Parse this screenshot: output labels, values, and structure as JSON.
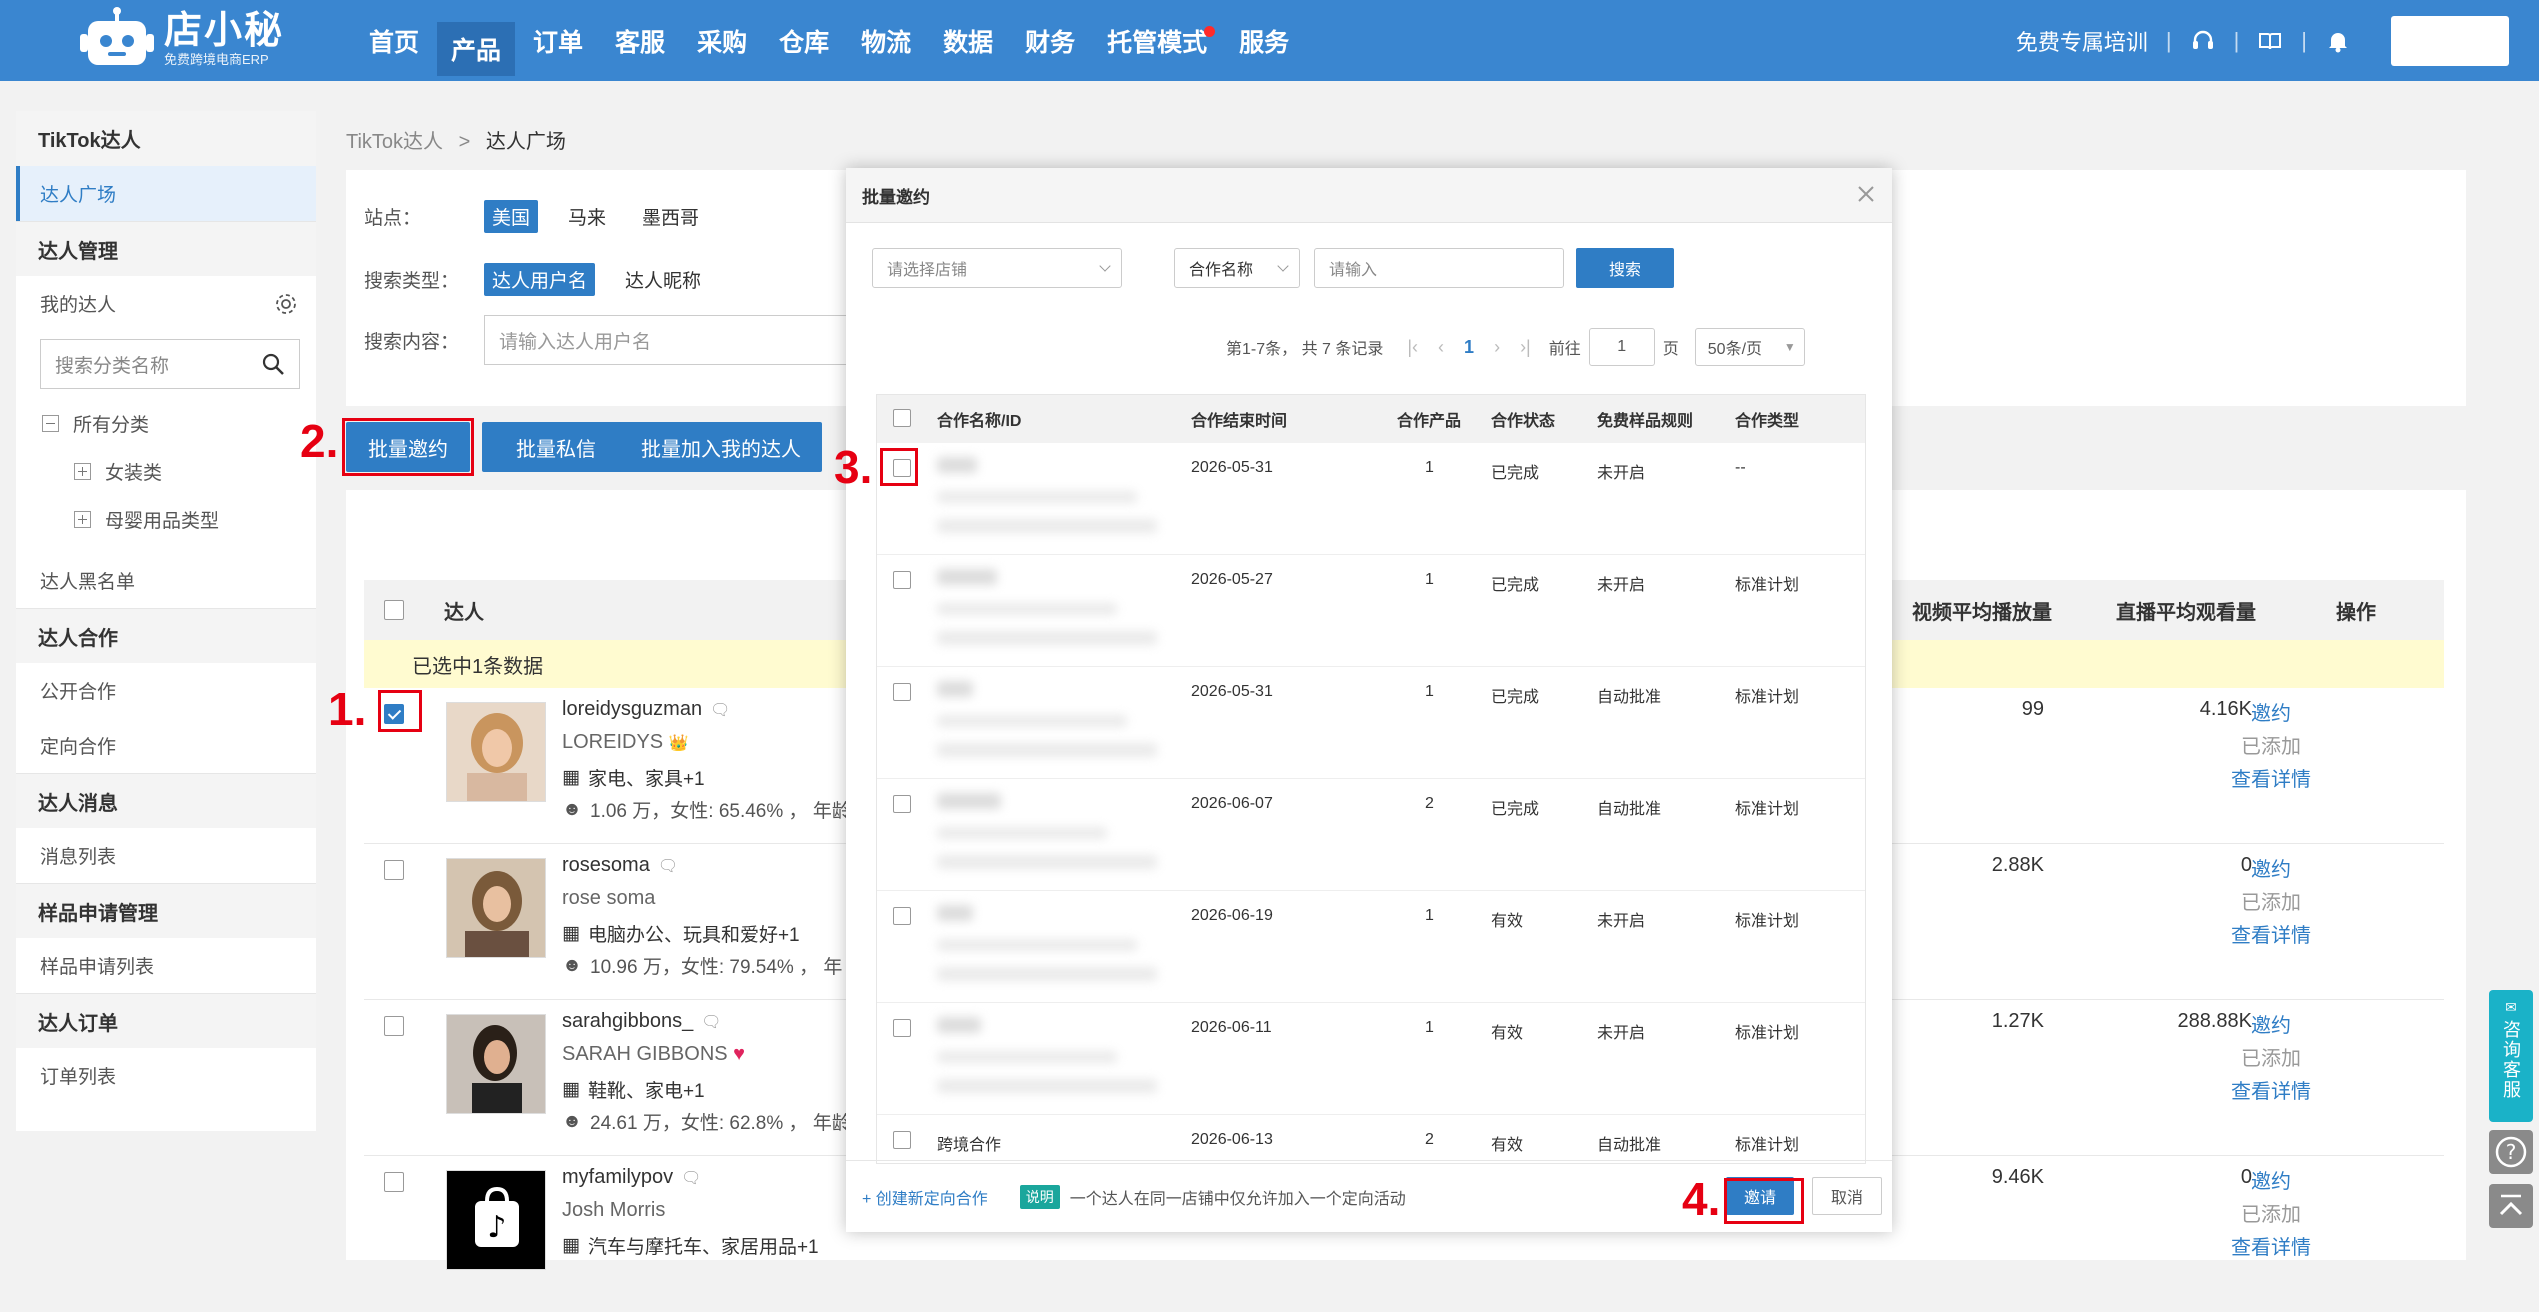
{
  "logo": {
    "name": "店小秘",
    "subtitle": "免费跨境电商ERP"
  },
  "nav": [
    "首页",
    "产品",
    "订单",
    "客服",
    "采购",
    "仓库",
    "物流",
    "数据",
    "财务",
    "托管模式",
    "服务"
  ],
  "top_right": {
    "training": "免费专属培训"
  },
  "sidebar": {
    "tiktok": "TikTok达人",
    "square": "达人广场",
    "manage": "达人管理",
    "my": "我的达人",
    "search_ph": "搜索分类名称",
    "all": "所有分类",
    "cat1": "女装类",
    "cat2": "母婴用品类型",
    "blacklist": "达人黑名单",
    "coop": "达人合作",
    "public": "公开合作",
    "directed": "定向合作",
    "msg": "达人消息",
    "msglist": "消息列表",
    "sample": "样品申请管理",
    "samplelist": "样品申请列表",
    "order": "达人订单",
    "orderlist": "订单列表"
  },
  "breadcrumb": {
    "parent": "TikTok达人",
    "sep": ">",
    "current": "达人广场"
  },
  "filters": {
    "site_label": "站点：",
    "sites": [
      "美国",
      "马来",
      "墨西哥"
    ],
    "type_label": "搜索类型：",
    "types": [
      "达人用户名",
      "达人昵称"
    ],
    "content_label": "搜索内容：",
    "content_ph": "请输入达人用户名"
  },
  "actions": {
    "batch_invite": "批量邀约",
    "batch_msg": "批量私信",
    "batch_add": "批量加入我的达人"
  },
  "steps": [
    "1.",
    "2.",
    "3.",
    "4."
  ],
  "list": {
    "col_creator": "达人",
    "col_video": "视频平均播放量",
    "col_live": "直播平均观看量",
    "col_op": "操作",
    "selected": "已选中1条数据",
    "rows": [
      {
        "user": "loreidysguzman",
        "nick": "LOREIDYS",
        "cats": "家电、家具+1",
        "fans": "1.06 万，女性: 65.46% ，  年龄",
        "video": "99",
        "live": "4.16K",
        "invite": "邀约",
        "added": "已添加",
        "detail": "查看详情"
      },
      {
        "user": "rosesoma",
        "nick": "rose soma",
        "cats": "电脑办公、玩具和爱好+1",
        "fans": "10.96 万，女性: 79.54% ，  年",
        "video": "2.88K",
        "live": "0",
        "invite": "邀约",
        "added": "已添加",
        "detail": "查看详情"
      },
      {
        "user": "sarahgibbons_",
        "nick": "SARAH GIBBONS",
        "cats": "鞋靴、家电+1",
        "fans": "24.61 万，女性: 62.8% ，  年龄",
        "video": "1.27K",
        "live": "288.88K",
        "invite": "邀约",
        "added": "已添加",
        "detail": "查看详情"
      },
      {
        "user": "myfamilypov",
        "nick": "Josh Morris",
        "cats": "汽车与摩托车、家居用品+1",
        "fans": "",
        "video": "9.46K",
        "live": "0",
        "invite": "邀约",
        "added": "已添加",
        "detail": "查看详情"
      }
    ]
  },
  "modal": {
    "title": "批量邀约",
    "store_ph": "请选择店铺",
    "field": "合作名称",
    "input_ph": "请输入",
    "search": "搜索",
    "pager_info": "第1-7条，  共 7 条记录",
    "page": "1",
    "goto": "前往",
    "goto_val": "1",
    "page_unit": "页",
    "per_page": "50条/页",
    "cols": [
      "合作名称/ID",
      "合作结束时间",
      "合作产品",
      "合作状态",
      "免费样品规则",
      "合作类型"
    ],
    "rows": [
      {
        "name": "",
        "end": "2026-05-31",
        "prod": "1",
        "status": "已完成",
        "rule": "未开启",
        "type": "--"
      },
      {
        "name": "",
        "end": "2026-05-27",
        "prod": "1",
        "status": "已完成",
        "rule": "未开启",
        "type": "标准计划"
      },
      {
        "name": "",
        "end": "2026-05-31",
        "prod": "1",
        "status": "已完成",
        "rule": "自动批准",
        "type": "标准计划"
      },
      {
        "name": "",
        "end": "2026-06-07",
        "prod": "2",
        "status": "已完成",
        "rule": "自动批准",
        "type": "标准计划"
      },
      {
        "name": "",
        "end": "2026-06-19",
        "prod": "1",
        "status": "有效",
        "rule": "未开启",
        "type": "标准计划"
      },
      {
        "name": "",
        "end": "2026-06-11",
        "prod": "1",
        "status": "有效",
        "rule": "未开启",
        "type": "标准计划"
      },
      {
        "name": "跨境合作",
        "end": "2026-06-13",
        "prod": "2",
        "status": "有效",
        "rule": "自动批准",
        "type": "标准计划"
      }
    ],
    "create": "+ 创建新定向合作",
    "explain_tag": "说明",
    "explain": "一个达人在同一店铺中仅允许加入一个定向活动",
    "invite": "邀请",
    "cancel": "取消"
  },
  "kefu": "咨询客服",
  "colors": {
    "primary": "#3a86d0",
    "highlight": "#e60012",
    "selected_bar": "#fffbd0"
  }
}
